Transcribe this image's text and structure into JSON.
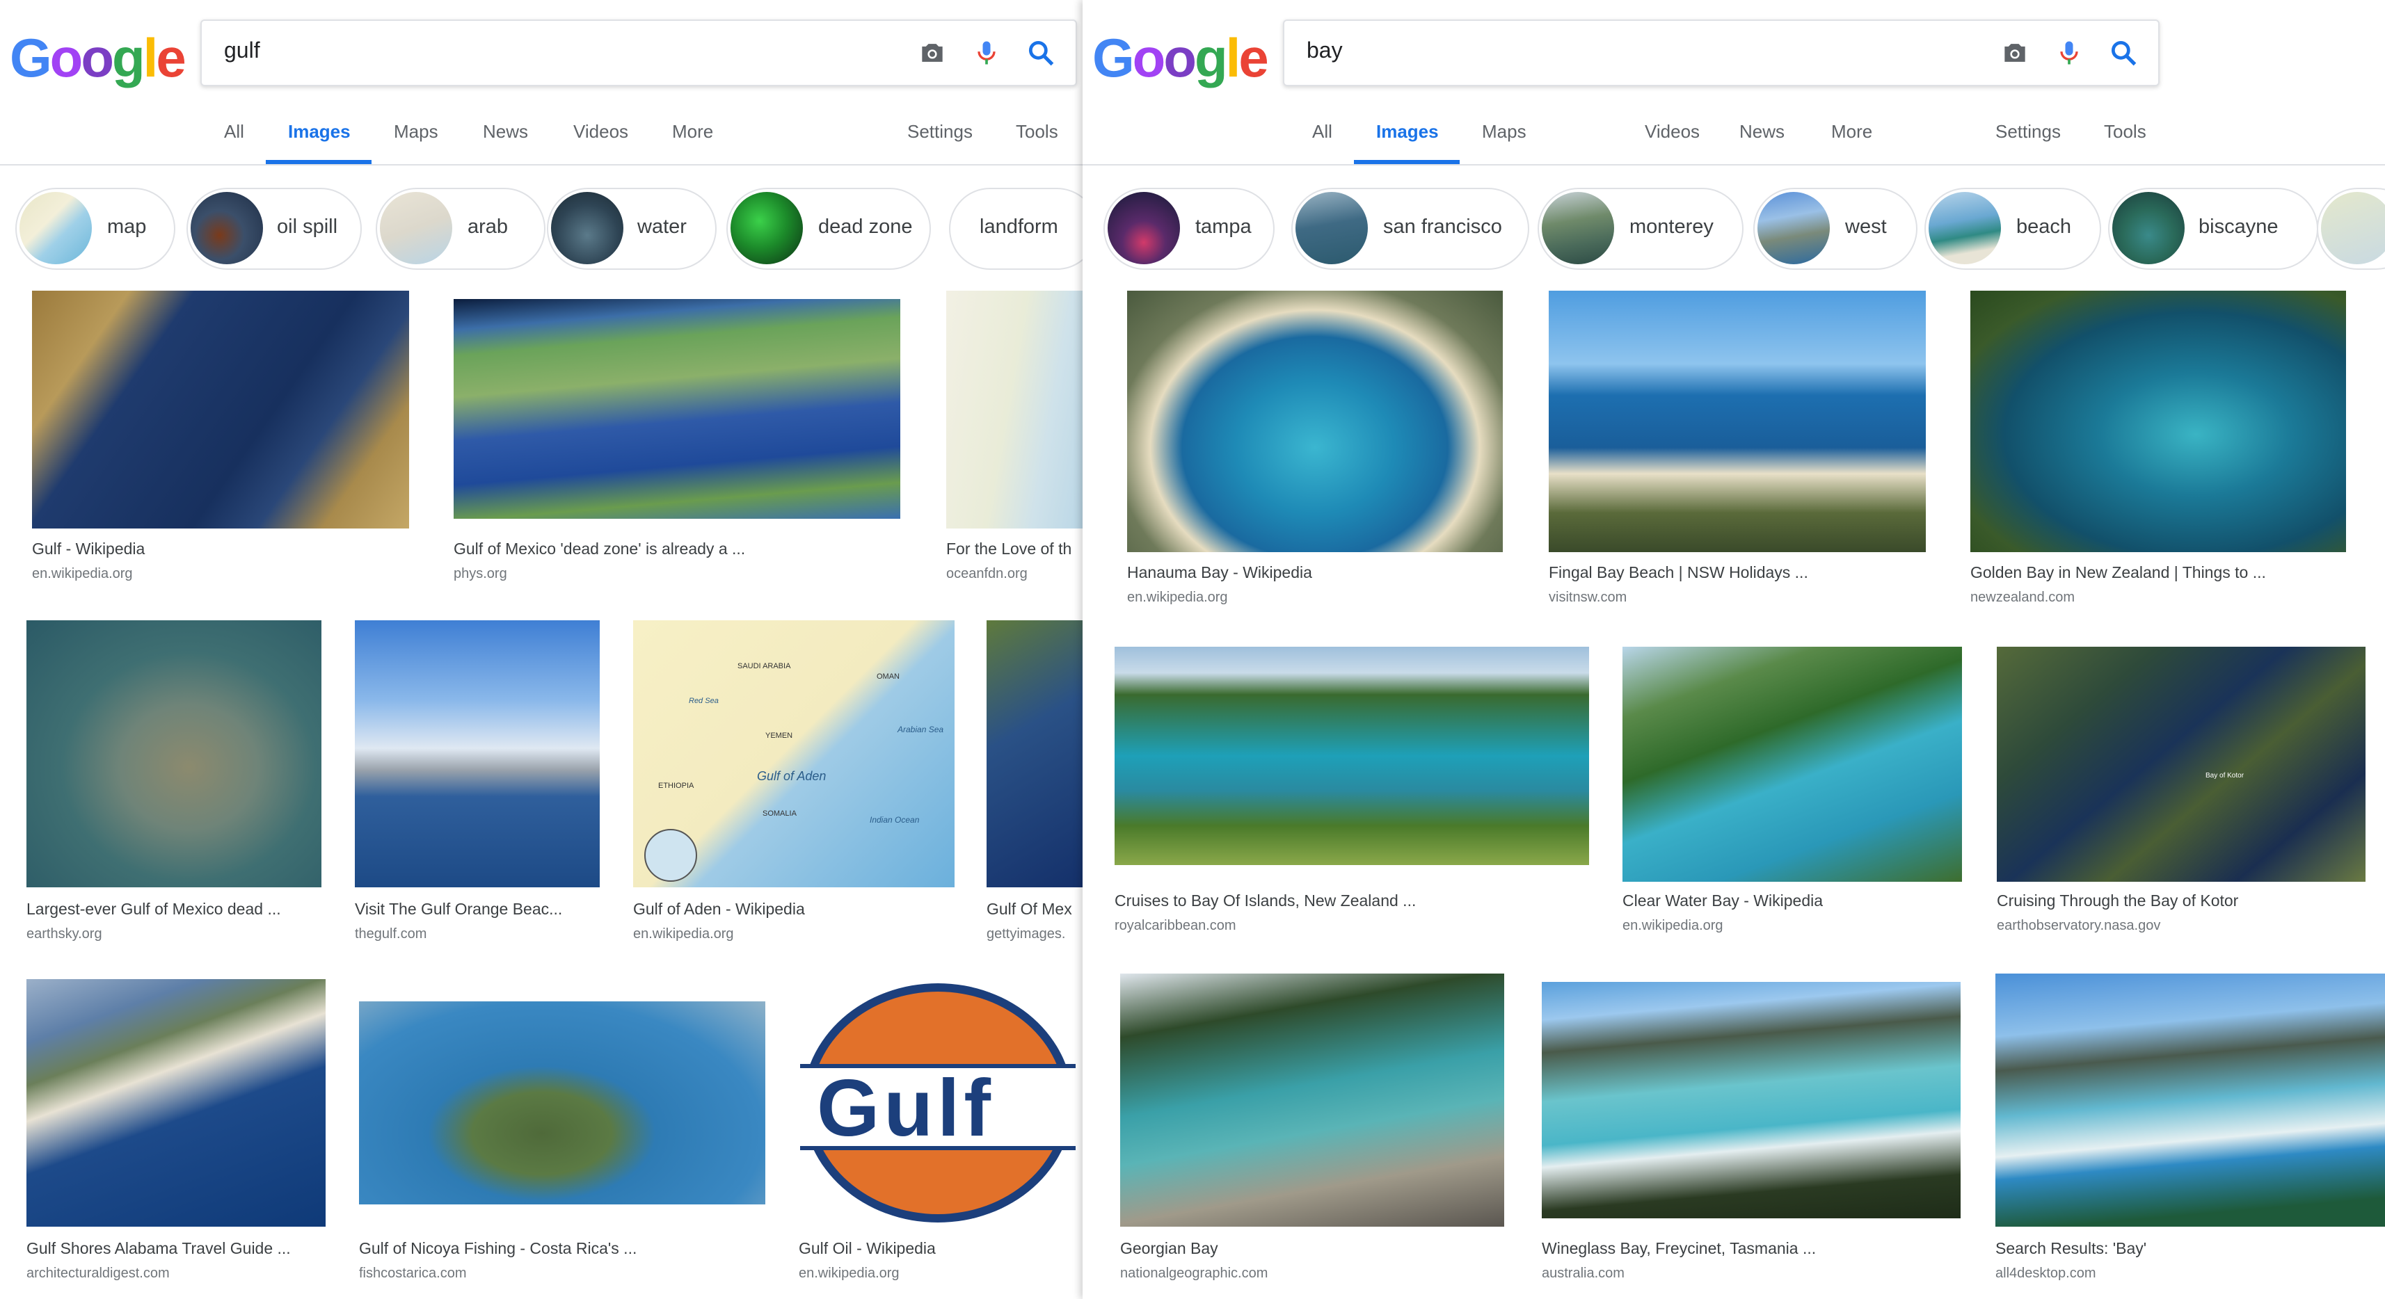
{
  "logo": {
    "g1": "G",
    "o1": "o",
    "o2": "o",
    "g2": "g",
    "l": "l",
    "e": "e"
  },
  "colors": {
    "accent": "#1a73e8",
    "text": "#202124",
    "muted": "#70757a",
    "border": "#dfe1e5"
  },
  "left": {
    "query": "gulf",
    "tabs": [
      "All",
      "Images",
      "Maps",
      "News",
      "Videos",
      "More"
    ],
    "settings": "Settings",
    "tools": "Tools",
    "chips": [
      "map",
      "oil spill",
      "arab",
      "water",
      "dead zone",
      "landform"
    ],
    "results": [
      {
        "title": "Gulf - Wikipedia",
        "source": "en.wikipedia.org"
      },
      {
        "title": "Gulf of Mexico 'dead zone' is already a ...",
        "source": "phys.org"
      },
      {
        "title": "For the Love of th",
        "source": "oceanfdn.org"
      },
      {
        "title": "Largest-ever Gulf of Mexico dead ...",
        "source": "earthsky.org"
      },
      {
        "title": "Visit The Gulf Orange Beac...",
        "source": "thegulf.com"
      },
      {
        "title": "Gulf of Aden - Wikipedia",
        "source": "en.wikipedia.org"
      },
      {
        "title": "Gulf Of Mex",
        "source": "gettyimages."
      },
      {
        "title": "Gulf Shores Alabama Travel Guide ...",
        "source": "architecturaldigest.com"
      },
      {
        "title": "Gulf of Nicoya Fishing - Costa Rica's ...",
        "source": "fishcostarica.com"
      },
      {
        "title": "Gulf Oil - Wikipedia",
        "source": "en.wikipedia.org"
      }
    ],
    "gulf_logo_text": "Gulf",
    "map_labels": [
      "SAUDI ARABIA",
      "OMAN",
      "YEMEN",
      "Gulf of Aden",
      "SOMALIA",
      "ETHIOPIA",
      "Arabian Sea",
      "Indian Ocean",
      "Red Sea"
    ]
  },
  "right": {
    "query": "bay",
    "tabs": [
      "All",
      "Images",
      "Maps",
      "Videos",
      "News",
      "More"
    ],
    "settings": "Settings",
    "tools": "Tools",
    "chips": [
      "tampa",
      "san francisco",
      "monterey",
      "west",
      "beach",
      "biscayne"
    ],
    "results": [
      {
        "title": "Hanauma Bay - Wikipedia",
        "source": "en.wikipedia.org"
      },
      {
        "title": "Fingal Bay Beach | NSW Holidays ...",
        "source": "visitnsw.com"
      },
      {
        "title": "Golden Bay in New Zealand | Things to ...",
        "source": "newzealand.com"
      },
      {
        "title": "Cruises to Bay Of Islands, New Zealand ...",
        "source": "royalcaribbean.com"
      },
      {
        "title": "Clear Water Bay - Wikipedia",
        "source": "en.wikipedia.org"
      },
      {
        "title": "Cruising Through the Bay of Kotor",
        "source": "earthobservatory.nasa.gov"
      },
      {
        "title": "Georgian Bay",
        "source": "nationalgeographic.com"
      },
      {
        "title": "Wineglass Bay, Freycinet, Tasmania ...",
        "source": "australia.com"
      },
      {
        "title": "Search Results: 'Bay'",
        "source": "all4desktop.com"
      }
    ],
    "kotor_label": "Bay of Kotor"
  }
}
